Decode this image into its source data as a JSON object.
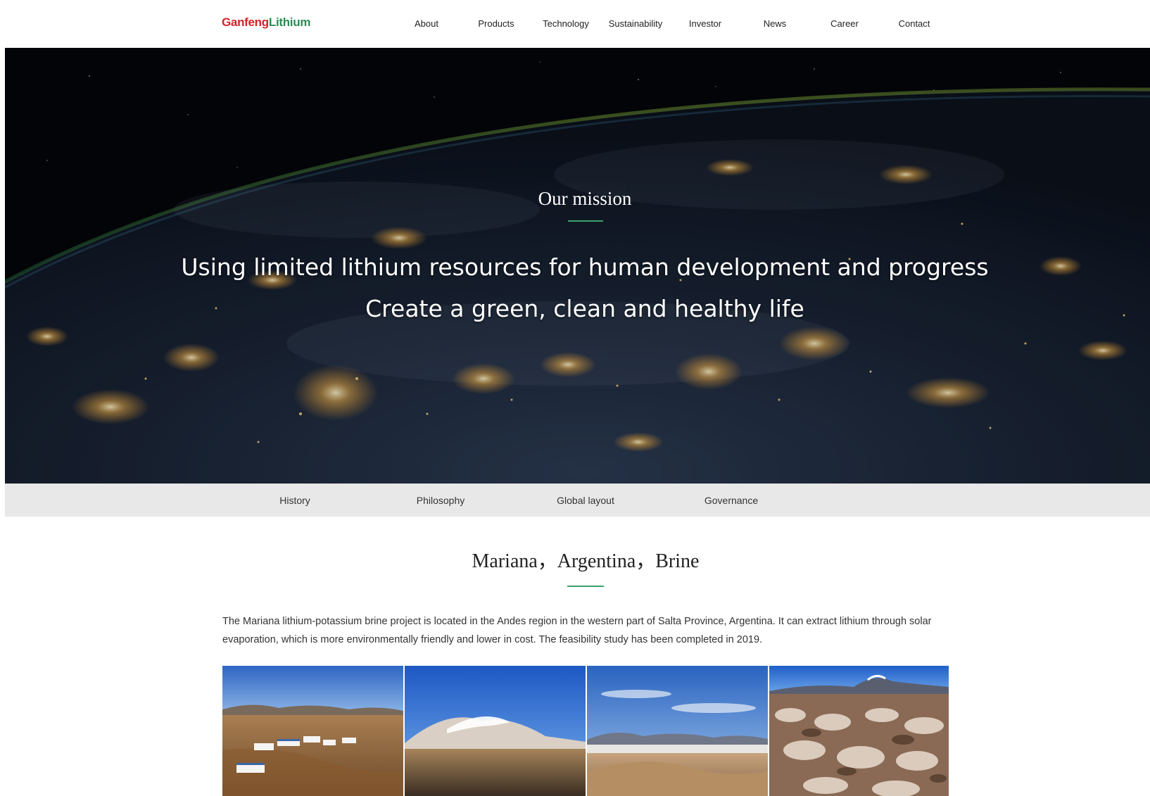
{
  "header": {
    "logo": {
      "part1": "Ganfeng",
      "part2": "Lithium"
    },
    "nav": [
      {
        "label": "About"
      },
      {
        "label": "Products"
      },
      {
        "label": "Technology"
      },
      {
        "label": "Sustainability"
      },
      {
        "label": "Investor"
      },
      {
        "label": "News"
      },
      {
        "label": "Career"
      },
      {
        "label": "Contact"
      }
    ]
  },
  "hero": {
    "title": "Our mission",
    "line1": "Using limited lithium resources for human development and progress",
    "line2": "Create a green, clean and healthy life"
  },
  "subnav": [
    {
      "label": "History"
    },
    {
      "label": "Philosophy"
    },
    {
      "label": "Global layout"
    },
    {
      "label": "Governance"
    }
  ],
  "section": {
    "title": "Mariana，Argentina，Brine",
    "description": "The Mariana lithium-potassium brine project is located in the Andes region in the western part of Salta Province, Argentina. It can extract lithium through solar evaporation, which is more environmentally friendly and lower in cost. The feasibility study has been completed in 2019."
  },
  "colors": {
    "logo_red": "#d2232a",
    "logo_green": "#2e8b57",
    "accent_green": "#3aa26a",
    "subnav_bg": "#e8e8e8"
  }
}
